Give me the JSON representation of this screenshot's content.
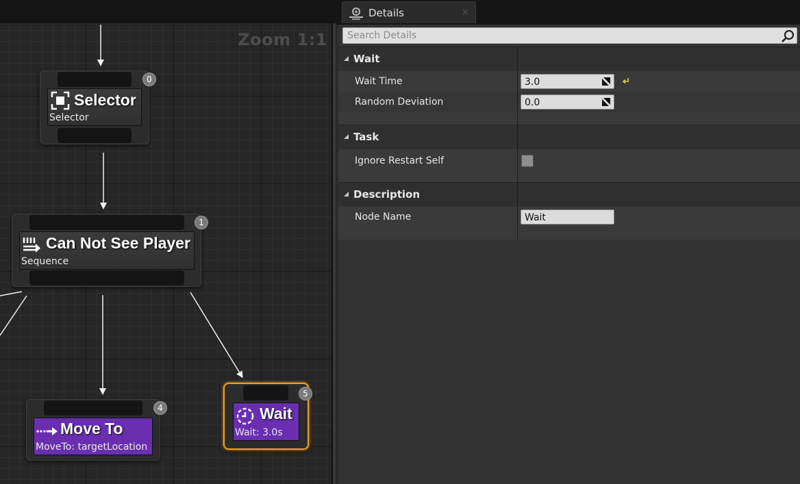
{
  "graph": {
    "zoom_label": "Zoom 1:1",
    "nodes": {
      "selector": {
        "title": "Selector",
        "subtitle": "Selector",
        "index": "0"
      },
      "sequence": {
        "title": "Can Not See Player",
        "subtitle": "Sequence",
        "index": "1"
      },
      "move_to": {
        "title": "Move To",
        "subtitle": "MoveTo: targetLocation",
        "index": "4",
        "color": "#6a2fb0"
      },
      "wait": {
        "title": "Wait",
        "subtitle": "Wait: 3.0s",
        "index": "5",
        "color": "#6a2fb0",
        "selected_outline": "#f0a020"
      }
    }
  },
  "details": {
    "tab": {
      "label": "Details",
      "icon": "details-panel-icon",
      "close": "×"
    },
    "search": {
      "placeholder": "Search Details"
    },
    "categories": {
      "wait": {
        "label": "Wait",
        "wait_time_label": "Wait Time",
        "wait_time_value": "3.0",
        "random_deviation_label": "Random Deviation",
        "random_deviation_value": "0.0"
      },
      "task": {
        "label": "Task",
        "ignore_restart_label": "Ignore Restart Self",
        "ignore_restart_checked": false
      },
      "description": {
        "label": "Description",
        "node_name_label": "Node Name",
        "node_name_value": "Wait"
      }
    }
  },
  "colors": {
    "accent_selected": "#f0a020",
    "task_node": "#6a2fb0",
    "reset_arrow": "#d8d040"
  }
}
